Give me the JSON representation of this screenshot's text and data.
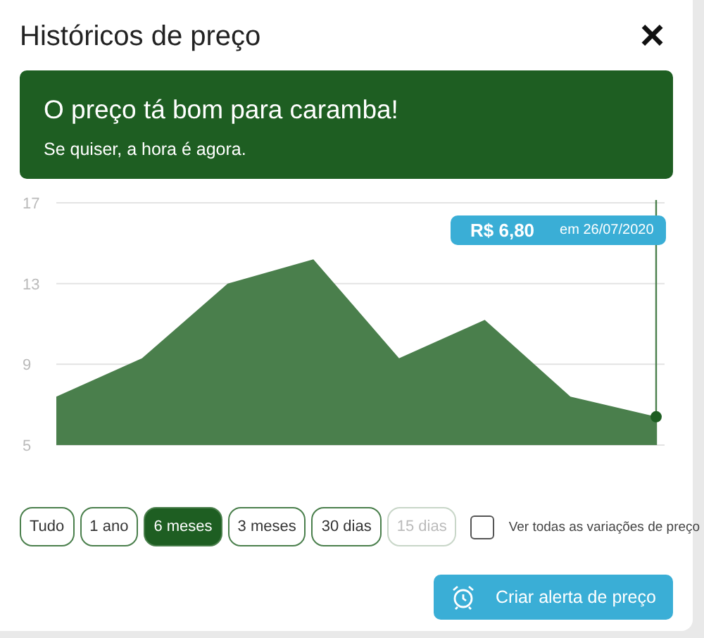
{
  "dialog": {
    "title": "Históricos de preço",
    "close_label": "×"
  },
  "banner": {
    "headline": "O preço tá bom para caramba!",
    "subtext": "Se quiser, a hora é agora."
  },
  "chart": {
    "tooltip": {
      "price": "R$ 6,80",
      "date": "em 26/07/2020"
    },
    "chart_data": {
      "type": "area",
      "series": [
        {
          "color": "#4a7f4c",
          "values": [
            7.4,
            9.3,
            13,
            14.2,
            9.3,
            11.2,
            7.4,
            6.4
          ]
        }
      ],
      "ylim": [
        5,
        17
      ],
      "yticks": [
        5,
        9,
        13,
        17
      ]
    }
  },
  "filters": [
    {
      "label": "Tudo",
      "selected": false,
      "disabled": false
    },
    {
      "label": "1 ano",
      "selected": false,
      "disabled": false
    },
    {
      "label": "6 meses",
      "selected": true,
      "disabled": false
    },
    {
      "label": "3 meses",
      "selected": false,
      "disabled": false
    },
    {
      "label": "30 dias",
      "selected": false,
      "disabled": false
    },
    {
      "label": "15 dias",
      "selected": false,
      "disabled": true
    }
  ],
  "show_all": {
    "label": "Ver todas as variações de preço",
    "checked": false
  },
  "alert_button": {
    "label": "Criar alerta de preço"
  }
}
